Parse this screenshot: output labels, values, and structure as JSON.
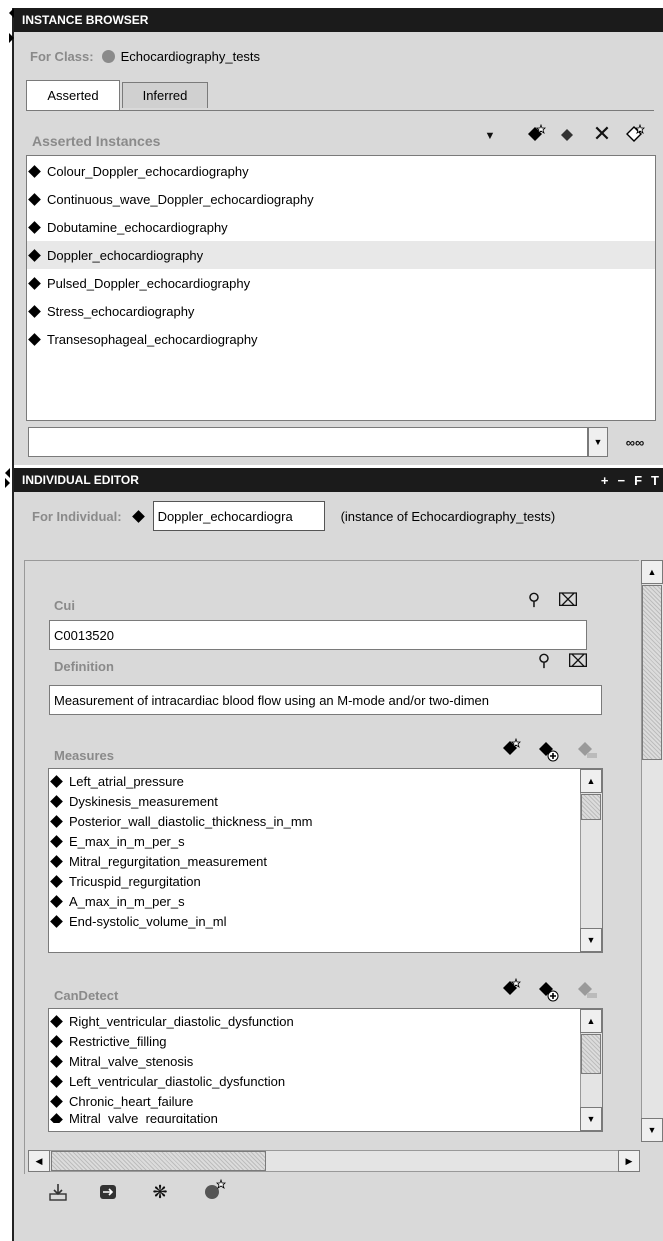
{
  "instance_browser": {
    "title": "INSTANCE BROWSER",
    "for_class_label": "For Class:",
    "class_name": "Echocardiography_tests",
    "tabs": [
      {
        "label": "Asserted"
      },
      {
        "label": "Inferred"
      }
    ],
    "asserted_instances_label": "Asserted Instances",
    "instances": [
      {
        "label": "Colour_Doppler_echocardiography"
      },
      {
        "label": "Continuous_wave_Doppler_echocardiography"
      },
      {
        "label": "Dobutamine_echocardiography"
      },
      {
        "label": "Doppler_echocardiography",
        "selected": true
      },
      {
        "label": "Pulsed_Doppler_echocardiography"
      },
      {
        "label": "Stress_echocardiography"
      },
      {
        "label": "Transesophageal_echocardiography"
      }
    ],
    "search_value": ""
  },
  "individual_editor": {
    "title": "INDIVIDUAL EDITOR",
    "header_controls": [
      "+",
      "−",
      "F",
      "T"
    ],
    "for_individual_label": "For Individual:",
    "individual_name": "Doppler_echocardiogra",
    "instance_of": "(instance of Echocardiography_tests)",
    "cui": {
      "label": "Cui",
      "value": "C0013520"
    },
    "definition": {
      "label": "Definition",
      "value": "Measurement of intracardiac blood flow using an M-mode and/or two-dimen"
    },
    "measures": {
      "label": "Measures",
      "items": [
        "Left_atrial_pressure",
        "Dyskinesis_measurement",
        "Posterior_wall_diastolic_thickness_in_mm",
        "E_max_in_m_per_s",
        "Mitral_regurgitation_measurement",
        "Tricuspid_regurgitation",
        "A_max_in_m_per_s",
        "End-systolic_volume_in_ml"
      ]
    },
    "can_detect": {
      "label": "CanDetect",
      "items": [
        "Right_ventricular_diastolic_dysfunction",
        "Restrictive_filling",
        "Mitral_valve_stenosis",
        "Left_ventricular_diastolic_dysfunction",
        "Chronic_heart_failure",
        "Mitral_valve_regurgitation"
      ]
    }
  },
  "icons": {
    "instance_toolbar": [
      "dropdown-arrow-icon",
      "create-instance-icon",
      "diamond-icon",
      "delete-icon",
      "copy-instance-icon"
    ],
    "search": "binoculars-icon",
    "field_actions": [
      "search-icon",
      "clear-icon"
    ],
    "list_actions": [
      "create-value-icon",
      "add-value-icon",
      "remove-value-icon"
    ],
    "bottom_toolbar": [
      "import-icon",
      "arrow-right-icon",
      "bug-icon",
      "create-class-icon"
    ]
  },
  "colors": {
    "header_bar": "#1b1b1b",
    "panel_bg": "#d9d9d9",
    "selected_row": "#e8e8e8"
  }
}
